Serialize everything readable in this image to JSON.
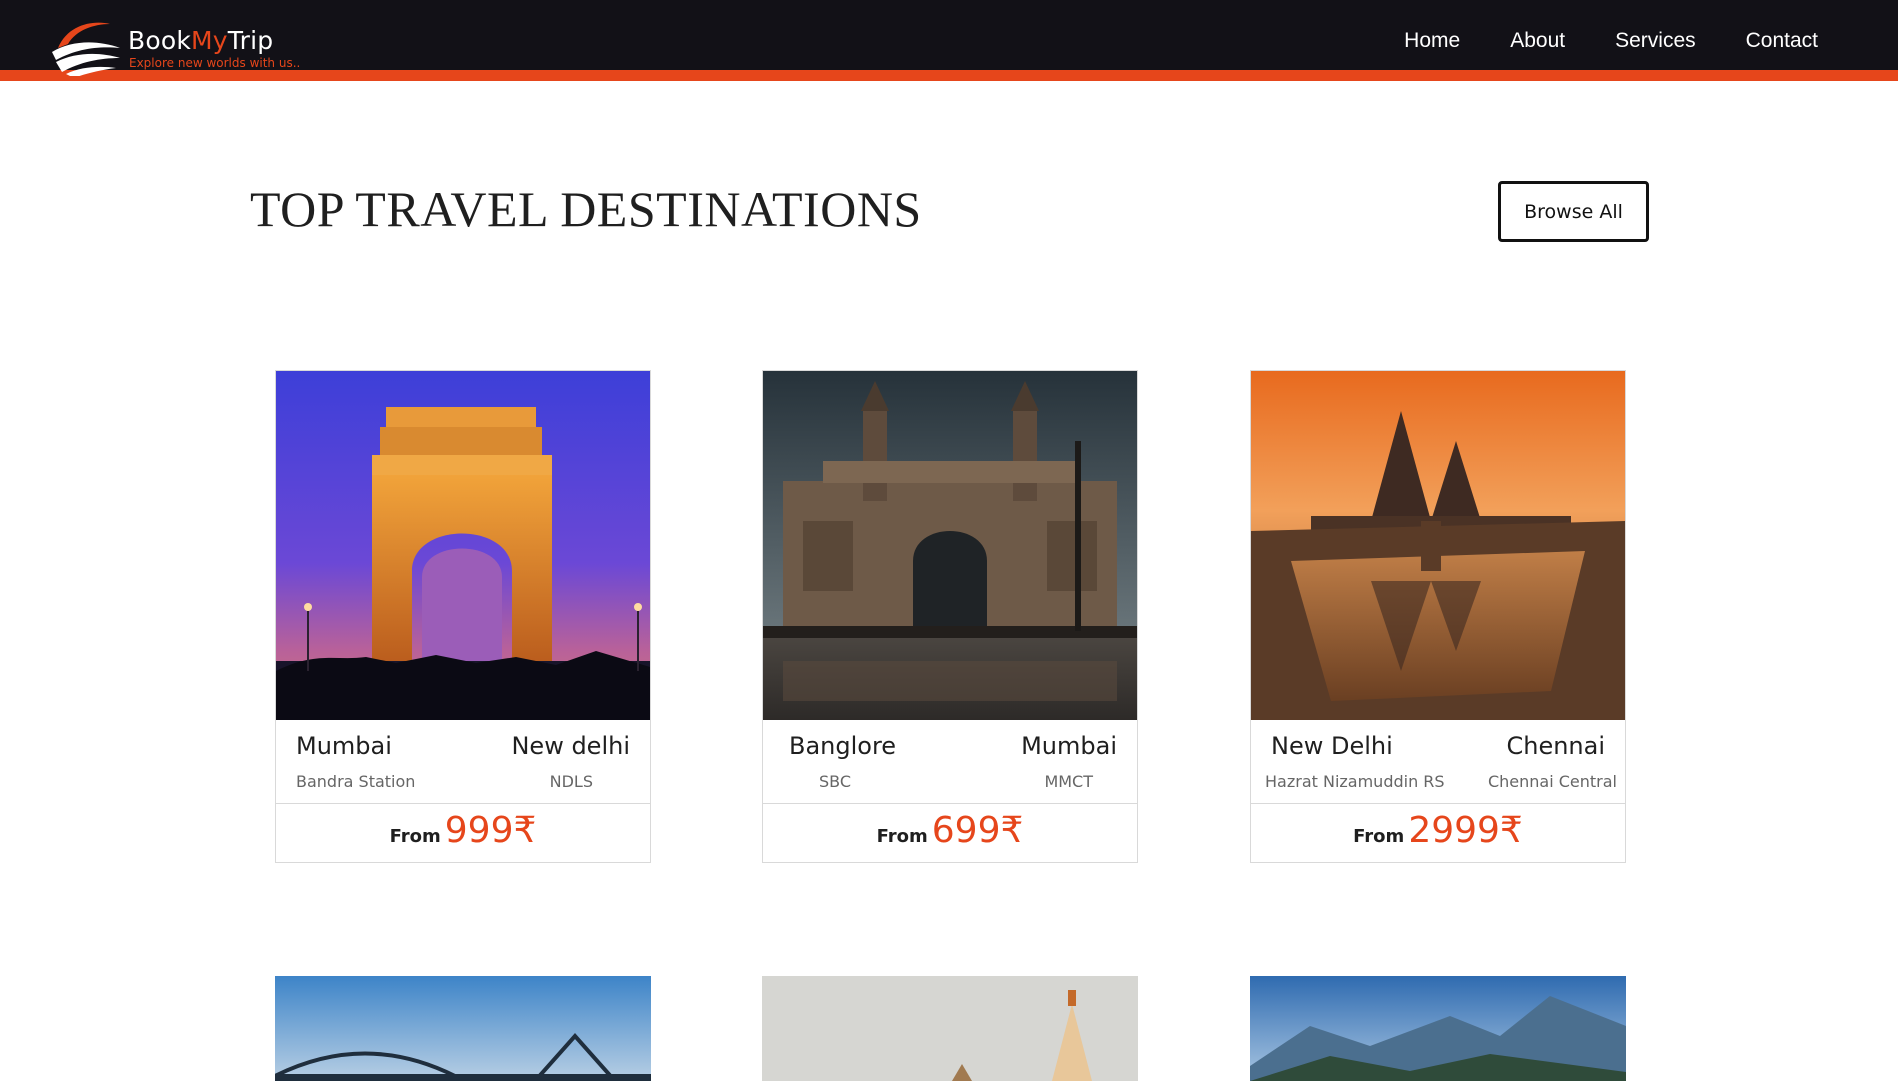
{
  "brand": {
    "name_part1": "Book",
    "name_part2": "My",
    "name_part3": "Trip",
    "tagline": "Explore new worlds with us..",
    "accent_color": "#e6461b",
    "nav_bg": "#121117"
  },
  "nav": {
    "items": [
      {
        "label": "Home"
      },
      {
        "label": "About"
      },
      {
        "label": "Services"
      },
      {
        "label": "Contact"
      }
    ]
  },
  "section": {
    "title": "TOP TRAVEL DESTINATIONS",
    "browse_label": "Browse All"
  },
  "cards": [
    {
      "from_city": "Mumbai",
      "to_city": "New delhi",
      "from_station": "Bandra Station",
      "to_station": "NDLS",
      "price_prefix": "From",
      "price": "999₹",
      "image_icon": "india-gate-image"
    },
    {
      "from_city": "Banglore",
      "to_city": "Mumbai",
      "from_station": "SBC",
      "to_station": "MMCT",
      "price_prefix": "From",
      "price": "699₹",
      "image_icon": "gateway-of-india-image"
    },
    {
      "from_city": "New Delhi",
      "to_city": "Chennai",
      "from_station": "Hazrat Nizamuddin RS",
      "to_station": "Chennai Central",
      "price_prefix": "From",
      "price": "2999₹",
      "image_icon": "shore-temple-image"
    }
  ],
  "next_row": [
    {
      "image_icon": "bridge-image"
    },
    {
      "image_icon": "temple-image"
    },
    {
      "image_icon": "mountains-image"
    }
  ]
}
